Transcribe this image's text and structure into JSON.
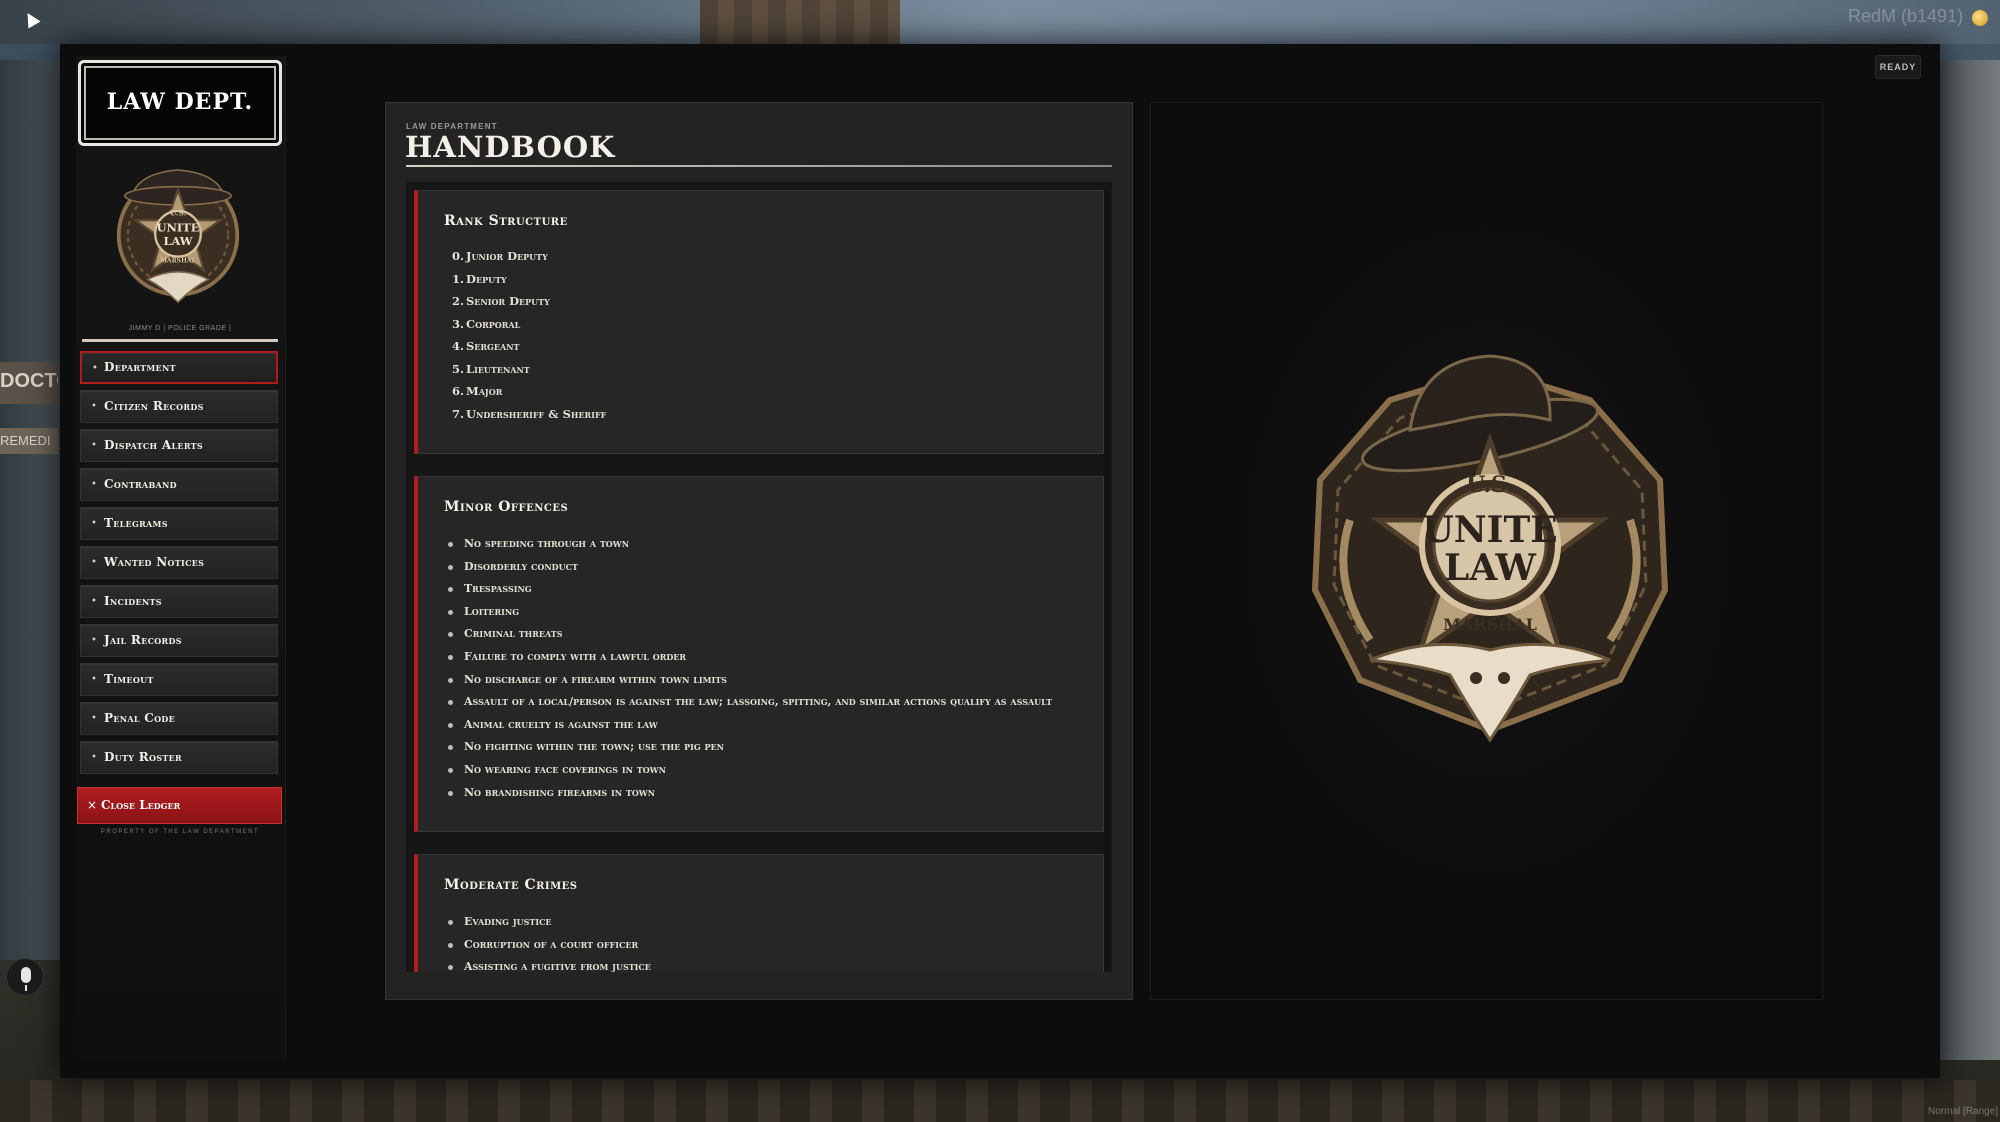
{
  "game_overlay": {
    "build": "RedM (b1491)",
    "mode": "Normal [Range]"
  },
  "window": {
    "status": "READY"
  },
  "sidebar": {
    "title": "LAW DEPT.",
    "badge": {
      "top_text": "U.S.",
      "line1": "UNITE",
      "line2": "LAW",
      "bottom_text": "MARSHAL",
      "icon": "sheriff-star-badge"
    },
    "user": "JIMMY D | POLICE GRADE |",
    "nav_items": [
      {
        "label": "Department",
        "active": true
      },
      {
        "label": "Citizen Records",
        "active": false
      },
      {
        "label": "Dispatch Alerts",
        "active": false
      },
      {
        "label": "Contraband",
        "active": false
      },
      {
        "label": "Telegrams",
        "active": false
      },
      {
        "label": "Wanted Notices",
        "active": false
      },
      {
        "label": "Incidents",
        "active": false
      },
      {
        "label": "Jail Records",
        "active": false
      },
      {
        "label": "Timeout",
        "active": false
      },
      {
        "label": "Penal Code",
        "active": false
      },
      {
        "label": "Duty Roster",
        "active": false
      }
    ],
    "close_label": "Close Ledger",
    "footer": "PROPERTY OF THE LAW DEPARTMENT"
  },
  "handbook": {
    "kicker": "LAW DEPARTMENT",
    "title": "HANDBOOK",
    "sections": {
      "rank": {
        "title": "Rank Structure",
        "items": [
          {
            "num": "0.",
            "text": "Junior Deputy"
          },
          {
            "num": "1.",
            "text": "Deputy"
          },
          {
            "num": "2.",
            "text": "Senior Deputy"
          },
          {
            "num": "3.",
            "text": "Corporal"
          },
          {
            "num": "4.",
            "text": "Sergeant"
          },
          {
            "num": "5.",
            "text": "Lieutenant"
          },
          {
            "num": "6.",
            "text": "Major"
          },
          {
            "num": "7.",
            "text": "Undersheriff & Sheriff"
          }
        ]
      },
      "minor": {
        "title": "Minor Offences",
        "items": [
          "No speeding through a town",
          "Disorderly conduct",
          "Trespassing",
          "Loitering",
          "Criminal threats",
          "Failure to comply with a lawful order",
          "No discharge of a firearm within town limits",
          "Assault of a local/person is against the law; lassoing, spitting, and similar actions qualify as assault",
          "Animal cruelty is against the law",
          "No fighting within the town; use the pig pen",
          "No wearing face coverings in town",
          "No brandishing firearms in town"
        ]
      },
      "moderate": {
        "title": "Moderate Crimes",
        "items": [
          "Evading justice",
          "Corruption of a court officer",
          "Assisting a fugitive from justice"
        ]
      }
    }
  },
  "colors": {
    "accent_red": "#b11d1f",
    "panel": "#232323",
    "badge_bronze": "#8a6f4a"
  }
}
